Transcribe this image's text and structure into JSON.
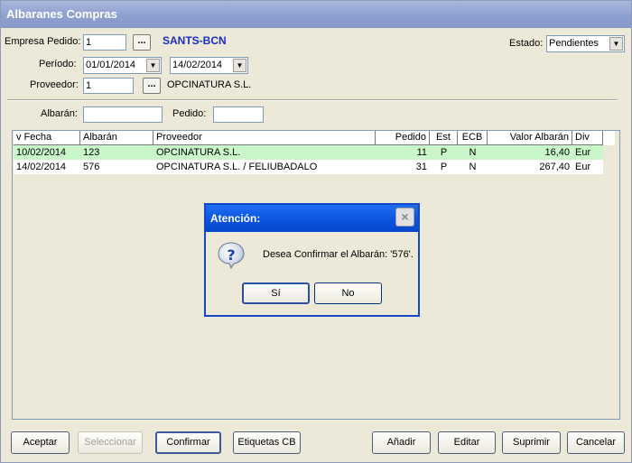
{
  "window": {
    "title": "Albaranes Compras"
  },
  "filters": {
    "empresa_label": "Empresa Pedido:",
    "empresa_value": "1",
    "empresa_name": "SANTS-BCN",
    "estado_label": "Estado:",
    "estado_value": "Pendientes",
    "periodo_label": "Período:",
    "fecha_desde": "01/01/2014",
    "fecha_hasta": "14/02/2014",
    "proveedor_label": "Proveedor:",
    "proveedor_value": "1",
    "proveedor_name": "OPCINATURA S.L.",
    "browse_label": "...",
    "albaran_label": "Albarán:",
    "albaran_value": "",
    "pedido_label": "Pedido:",
    "pedido_value": ""
  },
  "table": {
    "columns": [
      "v Fecha",
      "Albarán",
      "Proveedor",
      "Pedido",
      "Est",
      "ECB",
      "Valor Albarán",
      "Div"
    ],
    "rows": [
      {
        "fecha": "10/02/2014",
        "albaran": "123",
        "proveedor": "OPCINATURA S.L.",
        "pedido": "11",
        "est": "P",
        "ecb": "N",
        "valor": "16,40",
        "div": "Eur"
      },
      {
        "fecha": "14/02/2014",
        "albaran": "576",
        "proveedor": "OPCINATURA S.L. / FELIUBADALO",
        "pedido": "31",
        "est": "P",
        "ecb": "N",
        "valor": "267,40",
        "div": "Eur"
      }
    ]
  },
  "buttons": {
    "aceptar": "Aceptar",
    "seleccionar": "Seleccionar",
    "confirmar": "Confirmar",
    "etiquetas": "Etiquetas CB",
    "anadir": "Añadir",
    "editar": "Editar",
    "suprimir": "Suprimir",
    "cancelar": "Cancelar"
  },
  "dialog": {
    "title": "Atención:",
    "message": "Desea Confirmar el Albarán: '576'.",
    "yes": "Sí",
    "no": "No",
    "icon": "question-icon",
    "close": "×"
  },
  "colors": {
    "selected_row": "#c9f7c9",
    "title_dialog": "#0a52dc",
    "company_name": "#1a2fbf"
  }
}
